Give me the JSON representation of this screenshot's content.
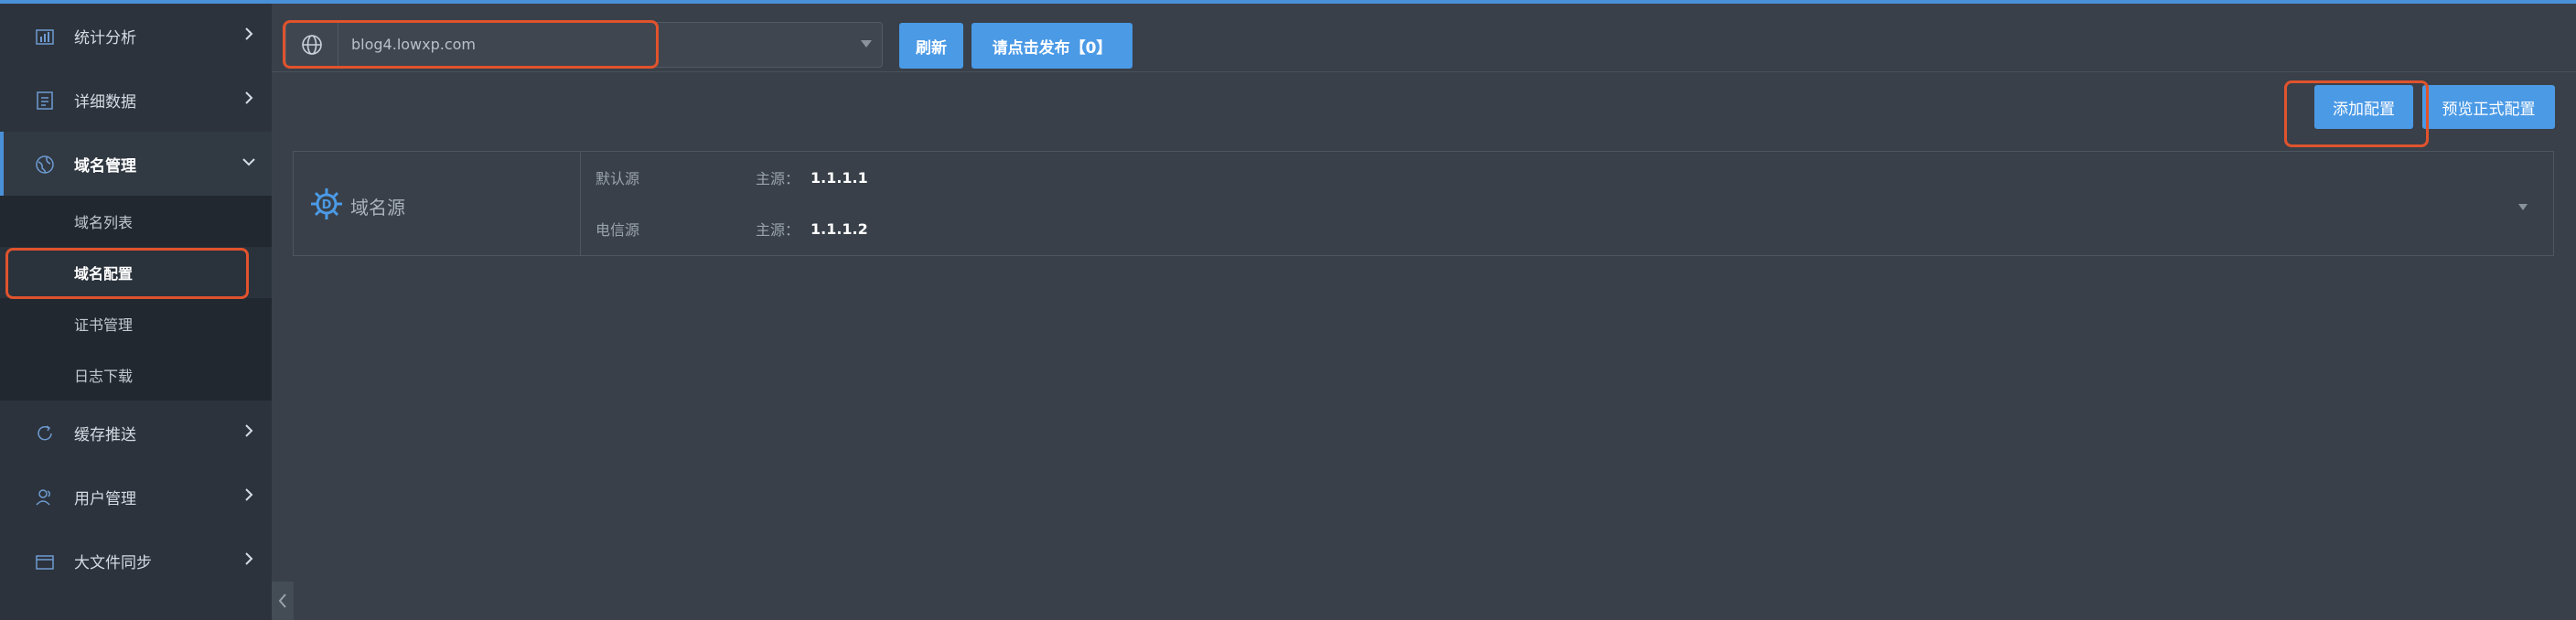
{
  "sidebar": {
    "items": [
      {
        "label": "统计分析",
        "icon": "bar-chart-icon"
      },
      {
        "label": "详细数据",
        "icon": "document-icon"
      },
      {
        "label": "域名管理",
        "icon": "globe-icon",
        "expanded": true
      },
      {
        "label": "缓存推送",
        "icon": "refresh-icon"
      },
      {
        "label": "用户管理",
        "icon": "users-icon"
      },
      {
        "label": "大文件同步",
        "icon": "folder-icon"
      }
    ],
    "submenu": [
      "域名列表",
      "域名配置",
      "证书管理",
      "日志下载"
    ],
    "selected_submenu": "域名配置"
  },
  "toolbar": {
    "domain_value": "blog4.lowxp.com",
    "refresh_label": "刷新",
    "publish_label": "请点击发布【0】"
  },
  "actions": {
    "add_config_label": "添加配置",
    "preview_config_label": "预览正式配置"
  },
  "panel": {
    "title": "域名源",
    "rows": [
      {
        "name": "默认源",
        "key": "主源：",
        "value": "1.1.1.1"
      },
      {
        "name": "电信源",
        "key": "主源：",
        "value": "1.1.1.2"
      }
    ]
  },
  "colors": {
    "accent": "#4b9ae6",
    "highlight": "#e0532d",
    "sidebar_bg": "#2c333c",
    "content_bg": "#394049"
  }
}
